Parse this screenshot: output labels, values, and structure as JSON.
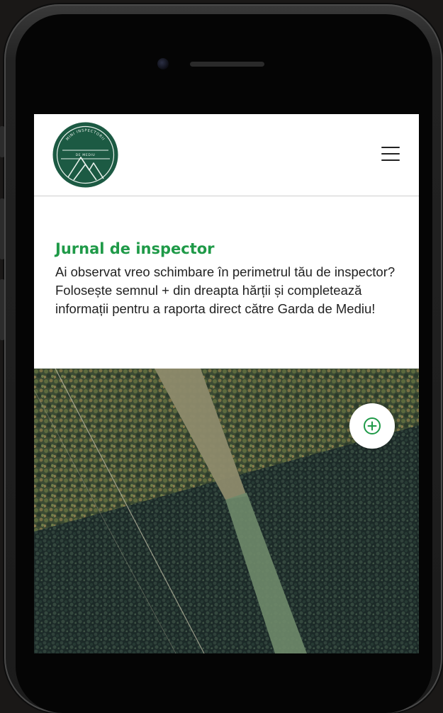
{
  "logo": {
    "arc_text": "MINI INSPECTORII",
    "inner_text": "DE MEDIU",
    "color": "#1c5a43"
  },
  "menu_icon": "hamburger-icon",
  "journal": {
    "title": "Jurnal de inspector",
    "description": "Ai observat vreo schimbare în perimetrul tău de inspector? Folosește semnul + din dreapta hărții și completează informații pentru a raporta direct către Garda de Mediu!"
  },
  "map": {
    "add_button_icon": "plus-circle-icon",
    "accent_color": "#1f9a48"
  }
}
